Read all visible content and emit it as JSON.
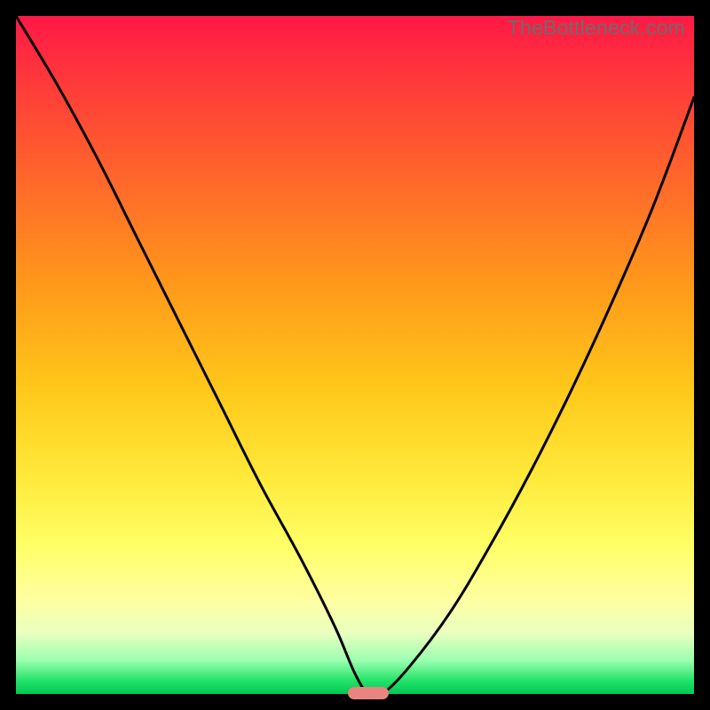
{
  "attribution": "TheBottleneck.com",
  "chart_data": {
    "type": "line",
    "title": "",
    "xlabel": "",
    "ylabel": "",
    "xlim": [
      0,
      100
    ],
    "ylim": [
      0,
      100
    ],
    "series": [
      {
        "name": "bottleneck-curve",
        "x": [
          0,
          6,
          12,
          18,
          24,
          30,
          36,
          42,
          47,
          50,
          52,
          54,
          58,
          64,
          70,
          76,
          82,
          88,
          94,
          100
        ],
        "values": [
          100,
          90,
          79,
          67,
          55,
          43,
          31,
          20,
          10,
          3,
          0,
          0,
          4,
          12,
          22,
          33,
          45,
          58,
          72,
          88
        ]
      }
    ],
    "valley_marker": {
      "x_start": 49,
      "x_end": 55,
      "y": 0
    },
    "gradient_stops": [
      {
        "offset": 0,
        "color": "#ff1846"
      },
      {
        "offset": 55,
        "color": "#ffc81a"
      },
      {
        "offset": 78,
        "color": "#ffff66"
      },
      {
        "offset": 100,
        "color": "#00c853"
      }
    ]
  }
}
